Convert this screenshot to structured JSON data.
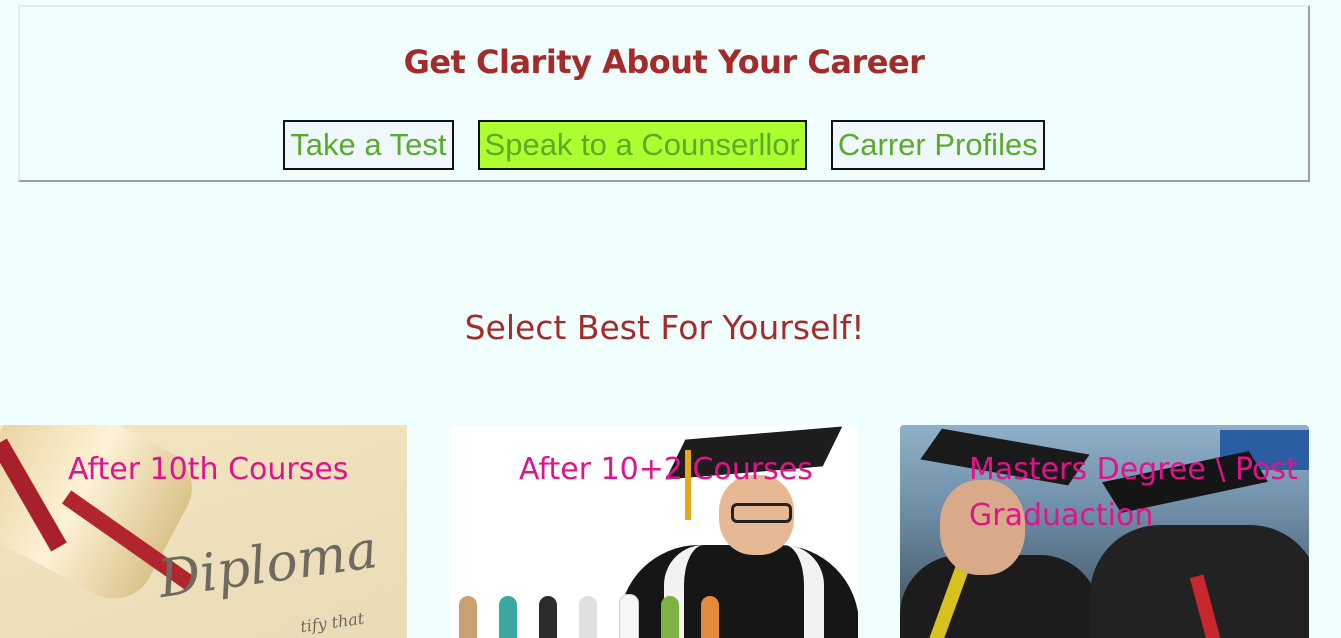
{
  "header": {
    "title": "Get Clarity About Your Career",
    "buttons": [
      {
        "label": "Take a Test"
      },
      {
        "label": "Speak to a Counserllor"
      },
      {
        "label": "Carrer Profiles"
      }
    ]
  },
  "section": {
    "title": "Select Best For Yourself!"
  },
  "cards": [
    {
      "caption": "After 10th Courses",
      "image_word": "Diploma",
      "image_script": "tify that"
    },
    {
      "caption": "After 10+2 Courses"
    },
    {
      "caption": "Masters Degree \\ Post Graduaction"
    }
  ],
  "colors": {
    "background": "#f0fffe",
    "title": "#a52a2a",
    "button_text": "#5aac28",
    "button_active_bg": "#adff2f",
    "caption": "#e0138c"
  }
}
